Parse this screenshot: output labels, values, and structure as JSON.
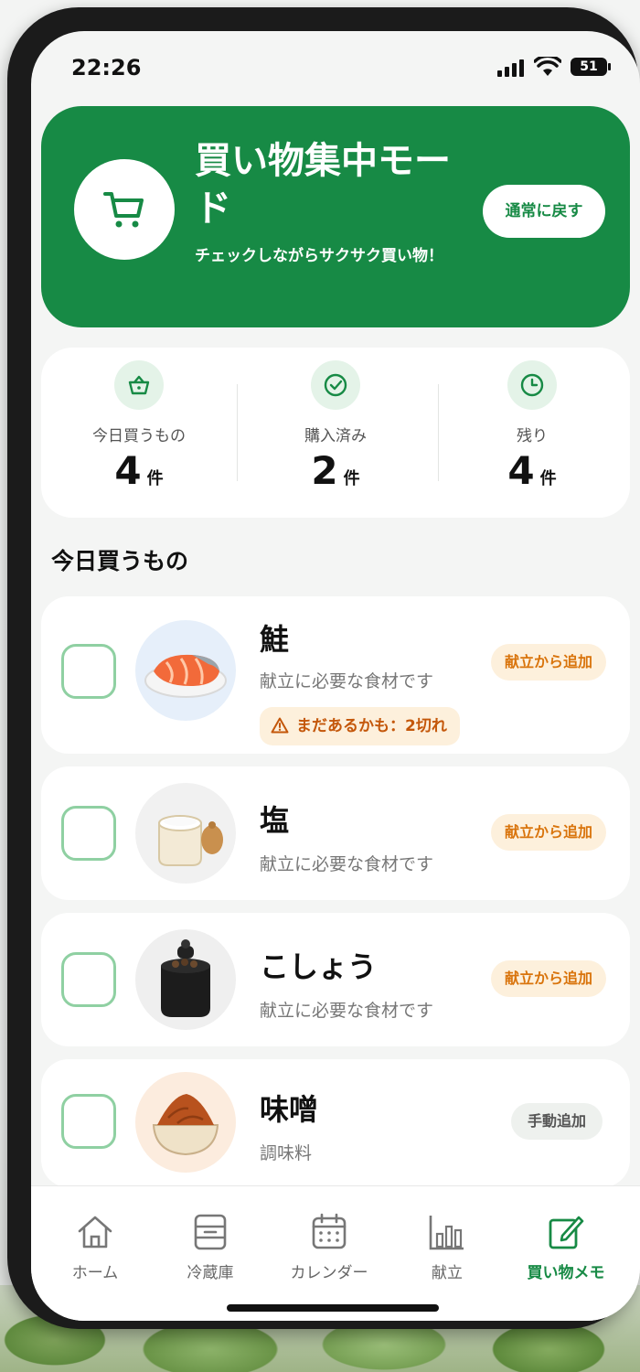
{
  "status": {
    "time": "22:26",
    "battery": "51"
  },
  "hero": {
    "title": "買い物集中モード",
    "subtitle": "チェックしながらサクサク買い物！",
    "back_button": "通常に戻す",
    "icon": "cart-icon",
    "color": "#178a45"
  },
  "stats": [
    {
      "label": "今日買うもの",
      "value": "4",
      "unit": "件",
      "icon": "basket-icon"
    },
    {
      "label": "購入済み",
      "value": "2",
      "unit": "件",
      "icon": "check-circle-icon"
    },
    {
      "label": "残り",
      "value": "4",
      "unit": "件",
      "icon": "clock-icon"
    }
  ],
  "section_title": "今日買うもの",
  "items": [
    {
      "name": "鮭",
      "desc": "献立に必要な食材です",
      "tag": "献立から追加",
      "warning": "まだあるかも：2切れ",
      "checked": false
    },
    {
      "name": "塩",
      "desc": "献立に必要な食材です",
      "tag": "献立から追加",
      "checked": false
    },
    {
      "name": "こしょう",
      "desc": "献立に必要な食材です",
      "tag": "献立から追加",
      "checked": false
    },
    {
      "name": "味噌",
      "desc": "調味料",
      "tag": "手動追加",
      "checked": false
    }
  ],
  "tabs": [
    {
      "label": "ホーム",
      "icon": "home-icon",
      "active": false
    },
    {
      "label": "冷蔵庫",
      "icon": "fridge-icon",
      "active": false
    },
    {
      "label": "カレンダー",
      "icon": "calendar-icon",
      "active": false
    },
    {
      "label": "献立",
      "icon": "chart-icon",
      "active": false
    },
    {
      "label": "買い物メモ",
      "icon": "memo-icon",
      "active": true
    }
  ],
  "colors": {
    "accent": "#178a45",
    "tag_orange": "#d9740c",
    "check_border": "#8fd0a2"
  }
}
